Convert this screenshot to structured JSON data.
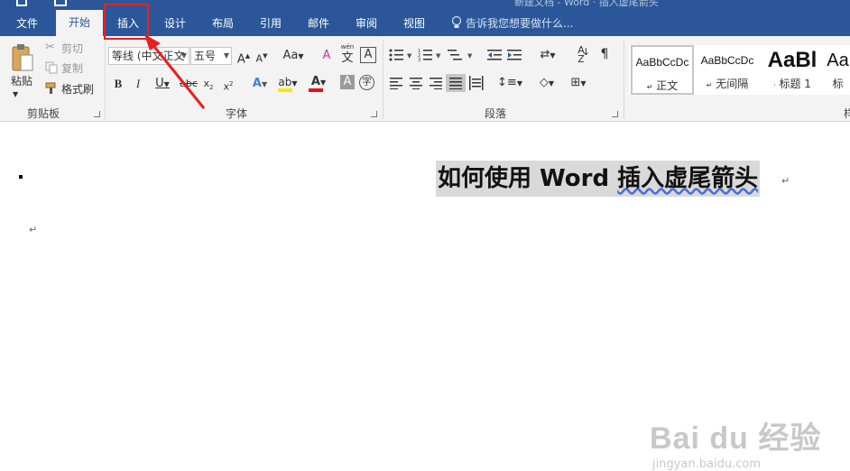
{
  "title_bar": {
    "partial_title": "新建文档 - Word · 插入虚尾箭头"
  },
  "tabs": [
    {
      "label": "文件"
    },
    {
      "label": "开始"
    },
    {
      "label": "插入"
    },
    {
      "label": "设计"
    },
    {
      "label": "布局"
    },
    {
      "label": "引用"
    },
    {
      "label": "邮件"
    },
    {
      "label": "审阅"
    },
    {
      "label": "视图"
    }
  ],
  "tell_me": "告诉我您想要做什么...",
  "clipboard": {
    "paste_label": "粘贴",
    "cut_label": "剪切",
    "copy_label": "复制",
    "format_painter_label": "格式刷",
    "group_label": "剪贴板"
  },
  "font": {
    "font_name": "等线 (中文正文",
    "font_size": "五号",
    "group_label": "字体",
    "pinyin_label": "wén"
  },
  "paragraph": {
    "group_label": "段落"
  },
  "styles": {
    "items": [
      {
        "sample": "AaBbCcDc",
        "name": "正文"
      },
      {
        "sample": "AaBbCcDc",
        "name": "无间隔"
      },
      {
        "sample": "AaBl",
        "name": "标题 1"
      },
      {
        "sample": "Aa",
        "name": "标"
      }
    ],
    "group_label_partial": "样"
  },
  "document": {
    "heading_prefix": "如何使用 Word ",
    "heading_wavy": "插入虚尾箭头",
    "para_mark": "↵"
  },
  "watermark": {
    "brand": "Bai du 经验",
    "url": "jingyan.baidu.com"
  },
  "colors": {
    "ribbon_blue": "#2b579a",
    "highlight_yellow": "#ffe600",
    "font_color_red": "#e81010",
    "annotation_red": "#e82020"
  }
}
